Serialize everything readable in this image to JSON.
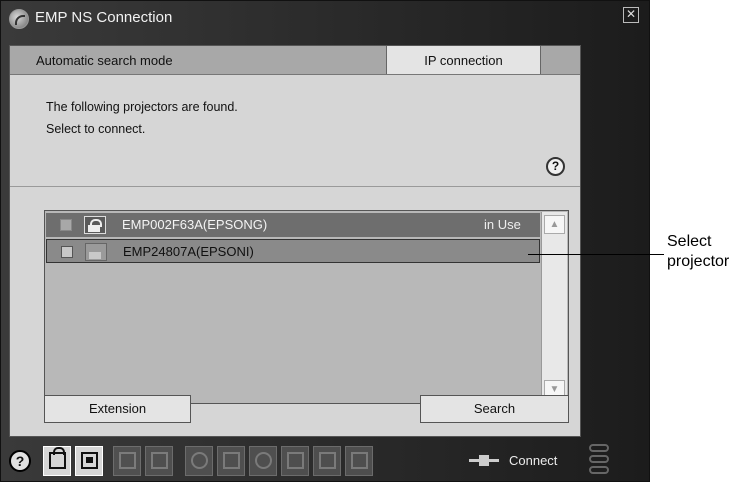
{
  "window": {
    "title": "EMP NS Connection",
    "close_glyph": "✕"
  },
  "tabs": {
    "auto_label": "Automatic search mode",
    "ip_label": "IP connection"
  },
  "message": {
    "line1": "The following projectors are found.",
    "line2": "Select to connect."
  },
  "help": {
    "glyph": "?"
  },
  "projectors": [
    {
      "name": "EMP002F63A(EPSONG)",
      "status": "in Use",
      "icon": "projector-locked-icon"
    },
    {
      "name": "EMP24807A(EPSONI)",
      "status": "",
      "icon": "projector-icon"
    }
  ],
  "scrollbar": {
    "up": "▲",
    "down": "▼"
  },
  "buttons": {
    "extension": "Extension",
    "search": "Search"
  },
  "toolbar": {
    "help_glyph": "?",
    "connect_label": "Connect"
  },
  "callout": {
    "line1": "Select",
    "line2": "projector"
  },
  "colors": {
    "window_bg": "#2b2b2b",
    "panel_bg": "#d6d6d6",
    "selected_row": "#6e6e6e",
    "highlight_row": "#8a8a8a"
  }
}
